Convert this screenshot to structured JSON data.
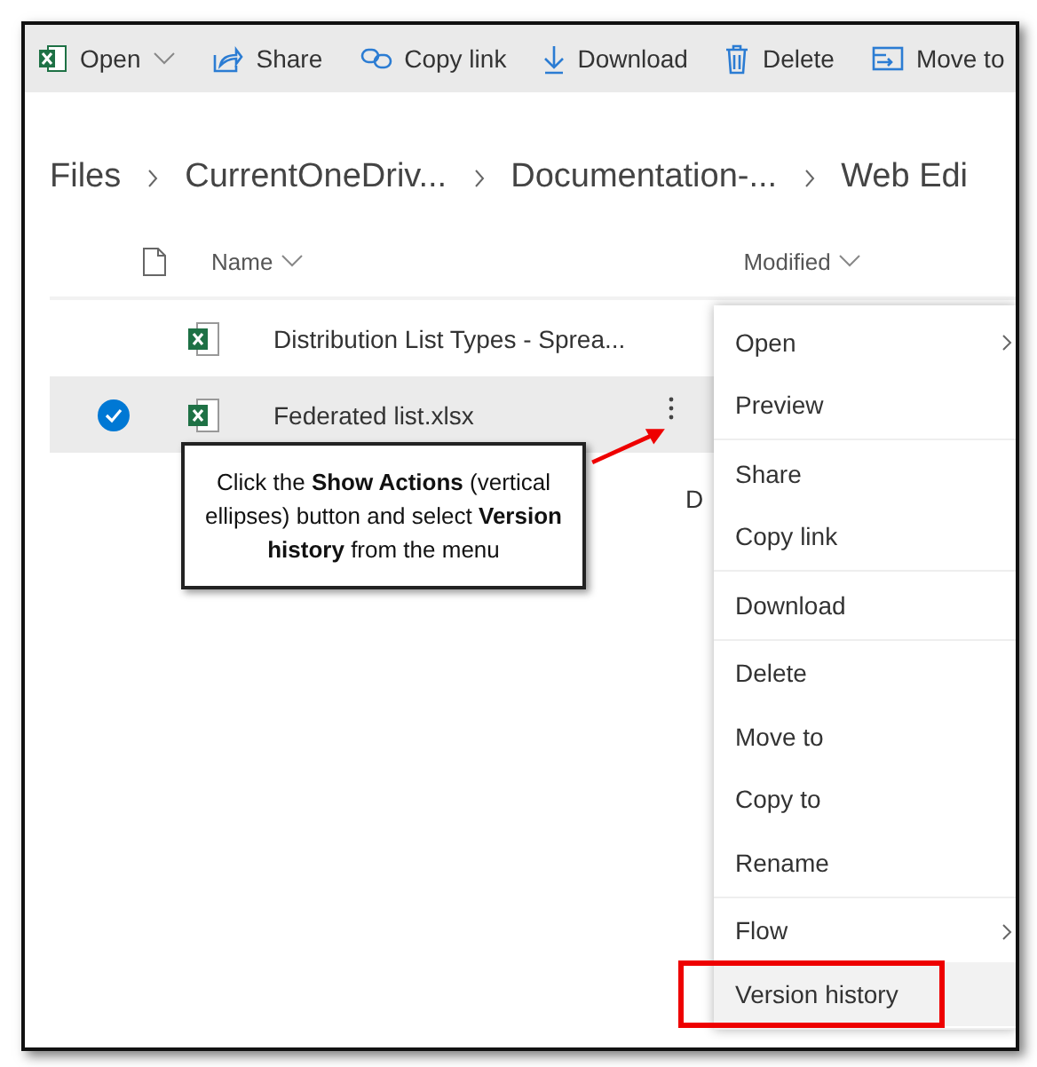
{
  "toolbar": [
    {
      "label": "Open",
      "has_menu": true
    },
    {
      "label": "Share",
      "has_menu": false
    },
    {
      "label": "Copy link",
      "has_menu": false
    },
    {
      "label": "Download",
      "has_menu": false
    },
    {
      "label": "Delete",
      "has_menu": false
    },
    {
      "label": "Move to",
      "has_menu": false
    }
  ],
  "breadcrumb": [
    "Files",
    "CurrentOneDriv...",
    "Documentation-...",
    "Web Edi"
  ],
  "columns": [
    "Name",
    "Modified"
  ],
  "rows": [
    {
      "name": "Distribution List Types - Sprea...",
      "selected": false
    },
    {
      "name": "Federated list.xlsx",
      "selected": true
    },
    {
      "modified": "D",
      "selected": false
    }
  ],
  "menu": {
    "groups": [
      [
        {
          "label": "Open",
          "submenu": true,
          "highlighted": false,
          "marked": false
        },
        {
          "label": "Preview",
          "submenu": false,
          "highlighted": false,
          "marked": false
        }
      ],
      [
        {
          "label": "Share",
          "submenu": false,
          "highlighted": false,
          "marked": false
        },
        {
          "label": "Copy link",
          "submenu": false,
          "highlighted": false,
          "marked": false
        }
      ],
      [
        {
          "label": "Download",
          "submenu": false,
          "highlighted": false,
          "marked": false
        }
      ],
      [
        {
          "label": "Delete",
          "submenu": false,
          "highlighted": false,
          "marked": false
        },
        {
          "label": "Move to",
          "submenu": false,
          "highlighted": false,
          "marked": false
        },
        {
          "label": "Copy to",
          "submenu": false,
          "highlighted": false,
          "marked": false
        },
        {
          "label": "Rename",
          "submenu": false,
          "highlighted": false,
          "marked": false
        }
      ],
      [
        {
          "label": "Flow",
          "submenu": true,
          "highlighted": false,
          "marked": false
        },
        {
          "label": "Version history",
          "submenu": false,
          "highlighted": true,
          "marked": true
        }
      ]
    ]
  },
  "callout": "Click the **Show Actions** (vertical ellipses) button and select **Version history** from the menu"
}
